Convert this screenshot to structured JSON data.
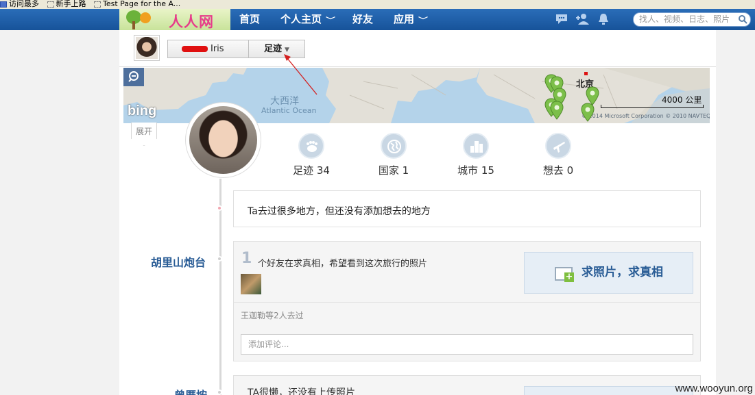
{
  "browser": {
    "bookmarks": [
      {
        "label": "访问最多",
        "icon": "bookmark-folder-icon"
      },
      {
        "label": "新手上路",
        "icon": "bookmark-page-icon"
      },
      {
        "label": "Test Page for the A...",
        "icon": "bookmark-page-icon"
      }
    ]
  },
  "nav": {
    "logo_text": "人人网",
    "items": [
      {
        "label": "首页",
        "has_menu": false
      },
      {
        "label": "个人主页",
        "has_menu": true
      },
      {
        "label": "好友",
        "has_menu": false
      },
      {
        "label": "应用",
        "has_menu": true
      }
    ],
    "icons": [
      "chat-icon",
      "friend-request-icon",
      "notification-bell-icon"
    ],
    "search_placeholder": "找人、视频、日志、照片"
  },
  "subbar": {
    "user_name": "Iris",
    "section_label": "足迹"
  },
  "map": {
    "ocean_cn": "大西洋",
    "ocean_en": "Atlantic Ocean",
    "city": "北京",
    "scale": "4000 公里",
    "copyright": "© 2014 Microsoft Corporation   © 2010 NAVTEQ",
    "brand": "bing",
    "expand_label": "展开"
  },
  "stats": [
    {
      "label": "足迹",
      "value": "34",
      "icon": "footprint-icon"
    },
    {
      "label": "国家",
      "value": "1",
      "icon": "globe-icon"
    },
    {
      "label": "城市",
      "value": "15",
      "icon": "city-icon"
    },
    {
      "label": "想去",
      "value": "0",
      "icon": "airplane-icon"
    }
  ],
  "note": "Ta去过很多地方，但还没有添加想去的地方",
  "trip": {
    "location": "胡里山炮台",
    "count": "1",
    "message": "个好友在求真相，希望看到这次旅行的照片",
    "request_button": "求照片，求真相",
    "went_text": "王迦勒等2人去过",
    "comment_placeholder": "添加评论..."
  },
  "next_trip": {
    "location": "曾厝垵",
    "message": "TA很懒，还没有上传照片"
  },
  "watermark": "www.wooyun.org",
  "colors": {
    "nav_bg": "#1e5fa8",
    "link_blue": "#2a5d96",
    "map_water": "#b4d3ea",
    "pin_green": "#7cbf4a"
  }
}
